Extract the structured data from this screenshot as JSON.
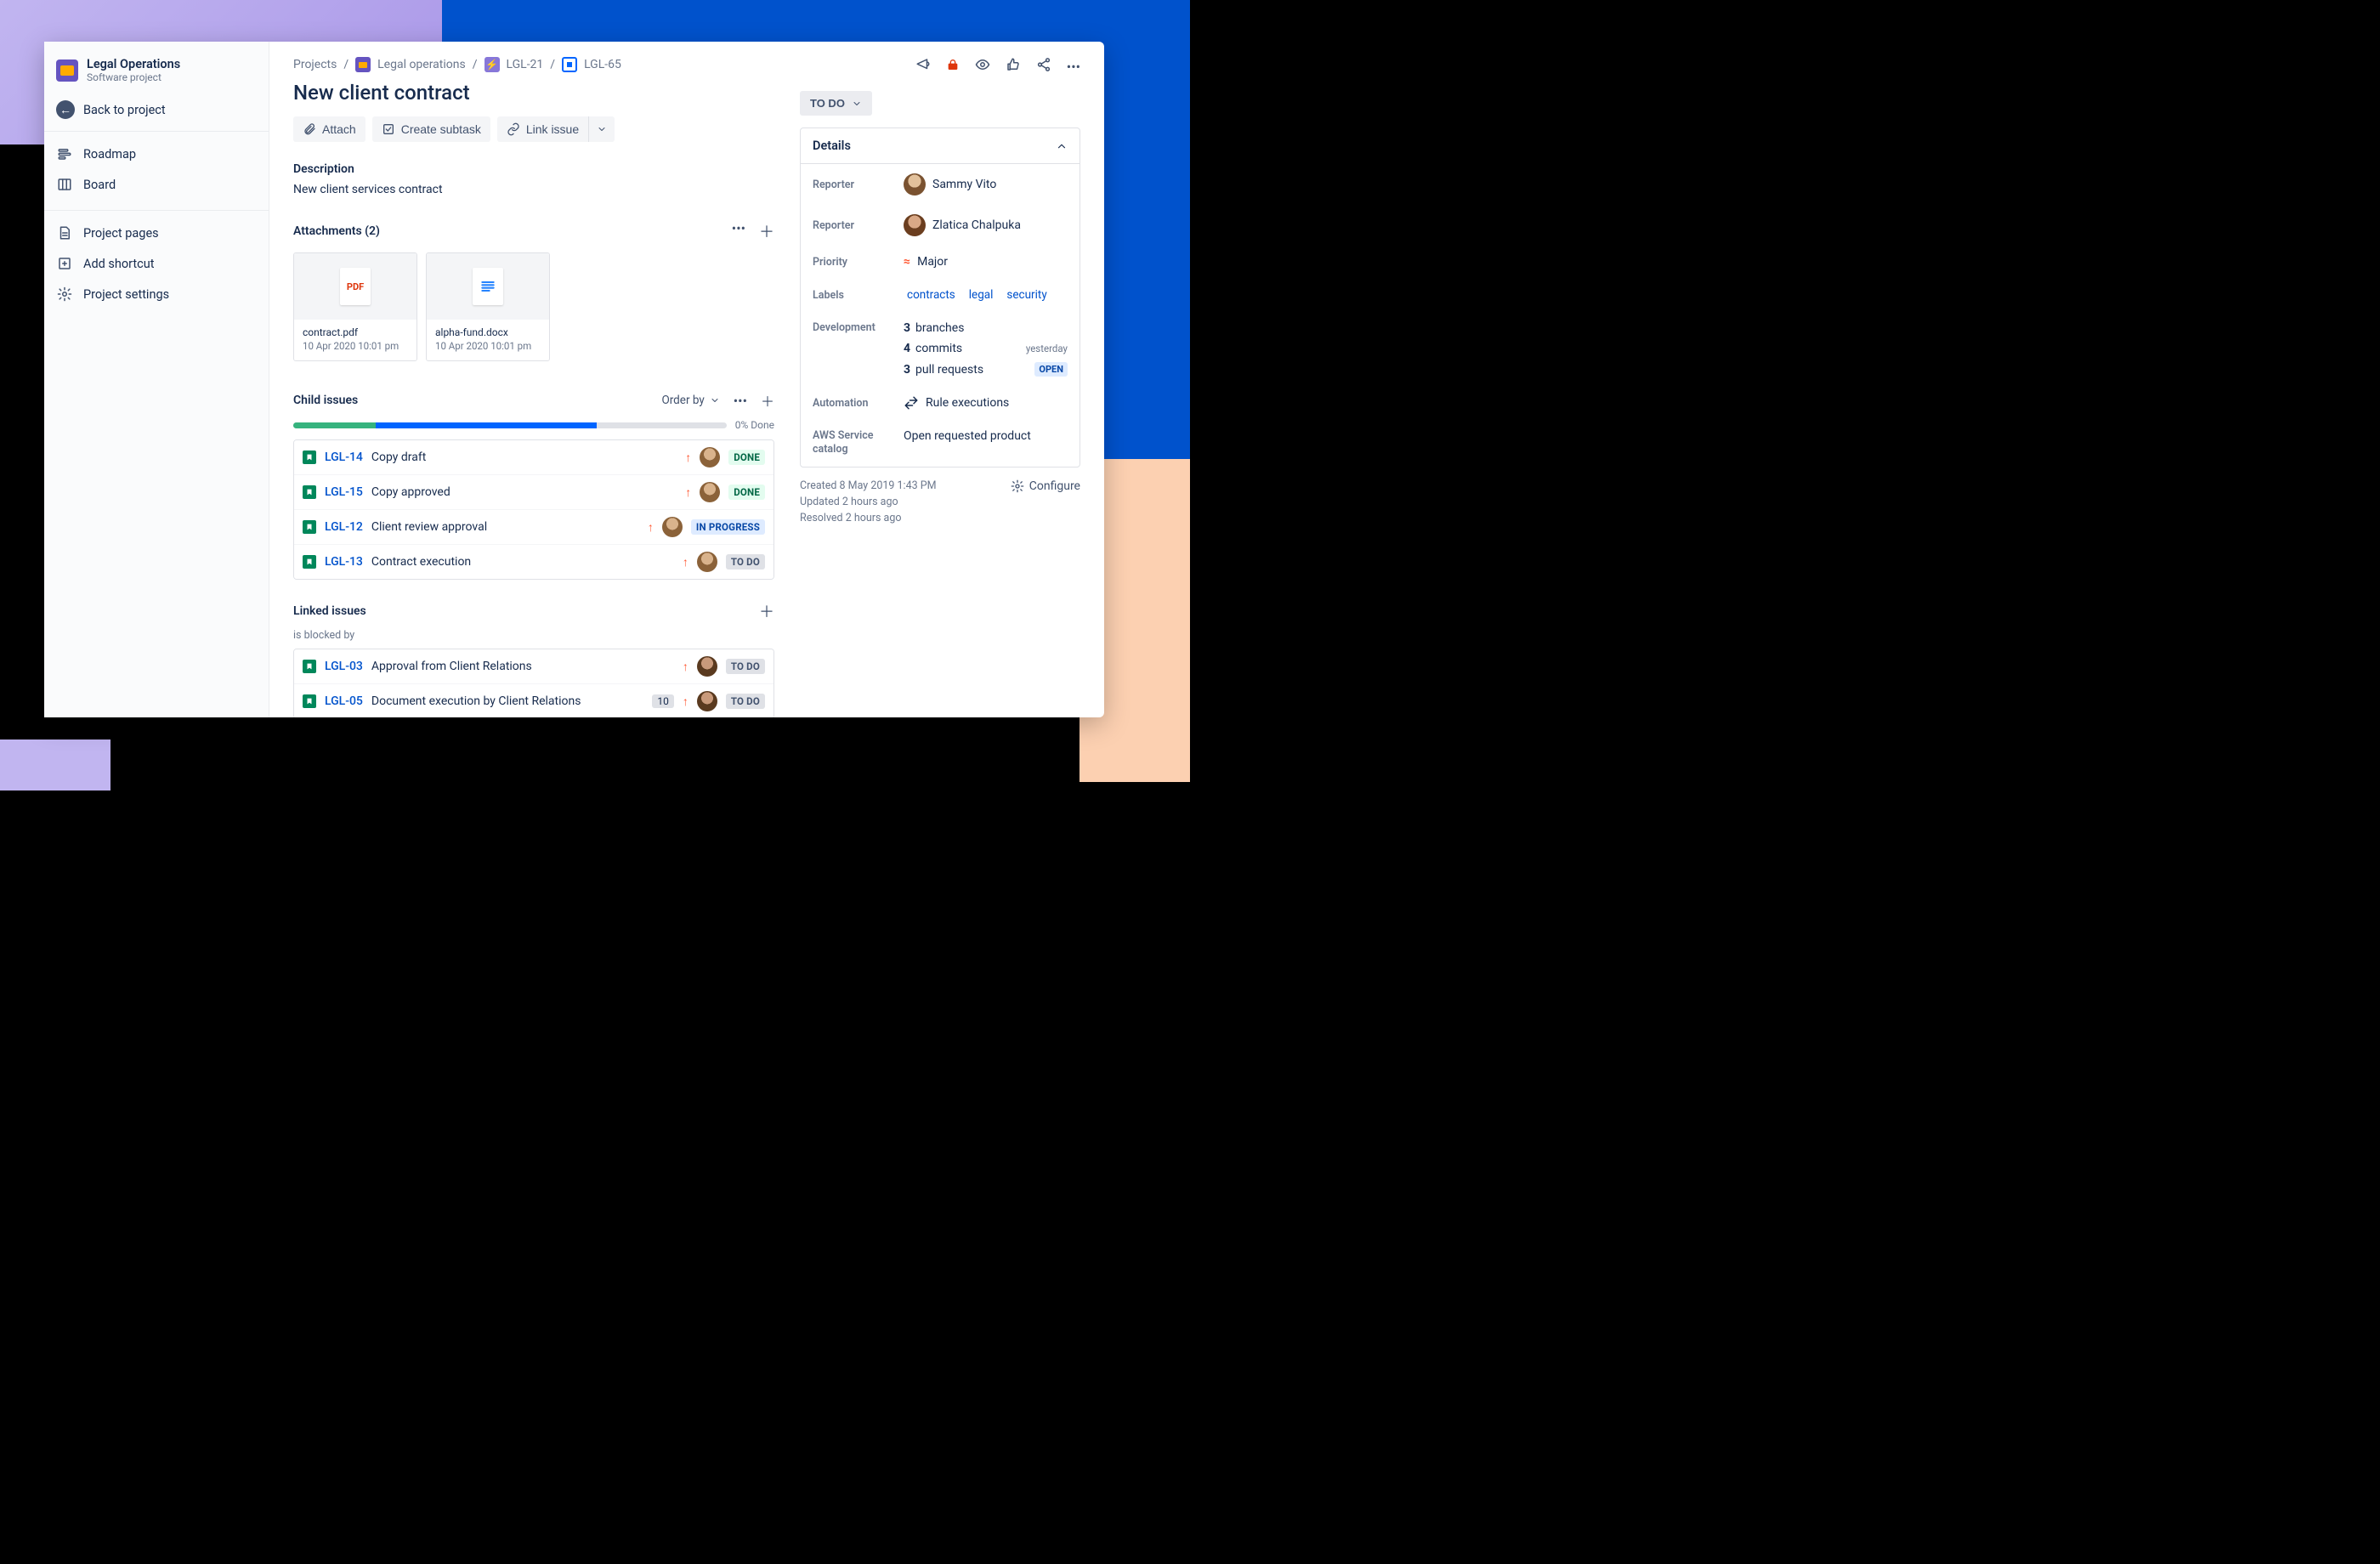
{
  "sidebar": {
    "project_title": "Legal Operations",
    "project_subtitle": "Software project",
    "back_label": "Back to project",
    "nav1": [
      {
        "label": "Roadmap",
        "icon": "roadmap"
      },
      {
        "label": "Board",
        "icon": "board"
      }
    ],
    "nav2": [
      {
        "label": "Project pages",
        "icon": "page"
      },
      {
        "label": "Add shortcut",
        "icon": "shortcut"
      },
      {
        "label": "Project settings",
        "icon": "gear"
      }
    ]
  },
  "breadcrumb": {
    "root": "Projects",
    "project": "Legal operations",
    "epic": "LGL-21",
    "issue": "LGL-65"
  },
  "issue": {
    "title": "New client contract",
    "status": "TO DO",
    "actions": {
      "attach": "Attach",
      "subtask": "Create subtask",
      "link": "Link issue"
    },
    "description": {
      "heading": "Description",
      "body": "New client services contract"
    }
  },
  "attachments": {
    "heading": "Attachments (2)",
    "items": [
      {
        "name": "contract.pdf",
        "date": "10 Apr 2020 10:01 pm",
        "type": "pdf",
        "badge": "PDF"
      },
      {
        "name": "alpha-fund.docx",
        "date": "10 Apr 2020 10:01 pm",
        "type": "doc"
      }
    ]
  },
  "child": {
    "heading": "Child issues",
    "order_label": "Order by",
    "progress": {
      "done_pct": 19,
      "inprog_pct": 51,
      "label": "0% Done"
    },
    "items": [
      {
        "key": "LGL-14",
        "summary": "Copy draft",
        "status": "DONE",
        "status_class": "done"
      },
      {
        "key": "LGL-15",
        "summary": "Copy approved",
        "status": "DONE",
        "status_class": "done"
      },
      {
        "key": "LGL-12",
        "summary": "Client review approval",
        "status": "IN PROGRESS",
        "status_class": "prog"
      },
      {
        "key": "LGL-13",
        "summary": "Contract execution",
        "status": "TO DO",
        "status_class": "todo"
      }
    ]
  },
  "linked": {
    "heading": "Linked issues",
    "relation": "is blocked by",
    "items": [
      {
        "key": "LGL-03",
        "summary": "Approval from Client Relations",
        "status": "TO DO",
        "status_class": "todo",
        "count": null
      },
      {
        "key": "LGL-05",
        "summary": "Document execution by Client Relations",
        "status": "TO DO",
        "status_class": "todo",
        "count": "10"
      }
    ]
  },
  "details": {
    "heading": "Details",
    "reporter1_label": "Reporter",
    "reporter1": "Sammy Vito",
    "reporter2_label": "Reporter",
    "reporter2": "Zlatica Chalpuka",
    "priority_label": "Priority",
    "priority": "Major",
    "labels_label": "Labels",
    "labels": [
      "contracts",
      "legal",
      "security"
    ],
    "dev_label": "Development",
    "dev": {
      "branches_n": "3",
      "branches_t": "branches",
      "commits_n": "4",
      "commits_t": "commits",
      "commits_m": "yesterday",
      "prs_n": "3",
      "prs_t": "pull requests",
      "prs_m": "OPEN"
    },
    "auto_label": "Automation",
    "auto_val": "Rule executions",
    "aws_label": "AWS Service catalog",
    "aws_val": "Open requested product"
  },
  "footer": {
    "created": "Created 8 May 2019 1:43 PM",
    "updated": "Updated 2 hours ago",
    "resolved": "Resolved 2 hours ago",
    "configure": "Configure"
  }
}
